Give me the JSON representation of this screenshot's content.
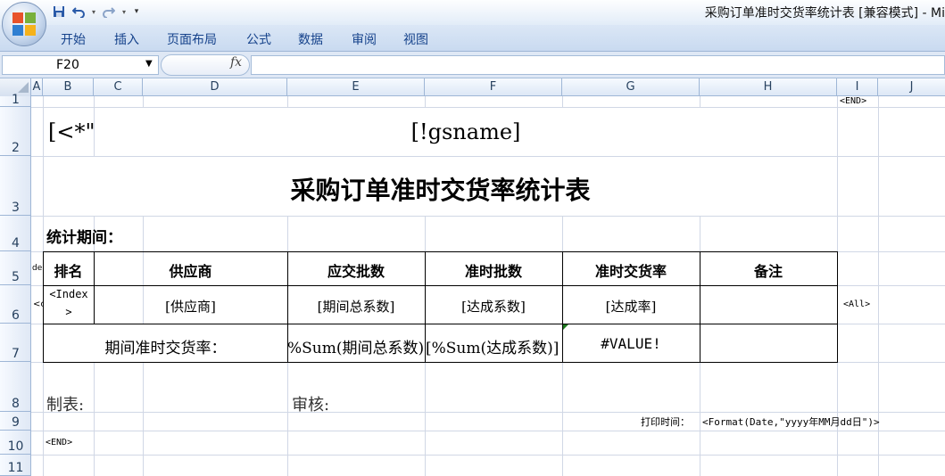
{
  "window": {
    "title": "采购订单准时交货率统计表  [兼容模式] - Mi"
  },
  "qat": {
    "save_icon": "save-icon",
    "undo_icon": "undo-icon",
    "redo_icon": "redo-icon",
    "customize_icon": "customize-qat-icon"
  },
  "ribbon": {
    "tabs": [
      "开始",
      "插入",
      "页面布局",
      "公式",
      "数据",
      "审阅",
      "视图"
    ]
  },
  "formula_bar": {
    "name_box": "F20",
    "fx": "fx",
    "formula": ""
  },
  "columns": [
    "A",
    "B",
    "C",
    "D",
    "E",
    "F",
    "G",
    "H",
    "I",
    "J"
  ],
  "rows": [
    "1",
    "2",
    "3",
    "4",
    "5",
    "6",
    "7",
    "8",
    "9",
    "10",
    "11"
  ],
  "cells": {
    "i1_end": "<END>",
    "b2_tag": "[<*\"",
    "gsname": "[!gsname]",
    "sheet_title": "采购订单准时交货率统计表",
    "period_label": "统计期间：",
    "a5_frag": "de",
    "headers": [
      "排名",
      "供应商",
      "应交批数",
      "准时批数",
      "准时交货率",
      "备注"
    ],
    "a6_frag": "<c",
    "index_line1": "<Index",
    "index_line2": ">",
    "supplier": "[供应商]",
    "period_total": "[期间总系数]",
    "achieved": "[达成系数]",
    "rate": "[达成率]",
    "i6_all": "<All>",
    "period_rate_label": "期间准时交货率：",
    "sum_total": "%Sum(期间总系数)",
    "sum_achieved": "[%Sum(达成系数)]",
    "value_error": "#VALUE!",
    "maker_label": "制表:",
    "reviewer_label": "审核:",
    "print_time_label": "打印时间：",
    "print_time_expr": "<Format(Date,\"yyyy年MM月dd日\")>",
    "b10_end": "<END>"
  },
  "colors": {
    "ribbon_text": "#15428b",
    "header_text": "#27415f",
    "grid": "#d0d7e5",
    "error_marker": "#1f7a1f"
  }
}
